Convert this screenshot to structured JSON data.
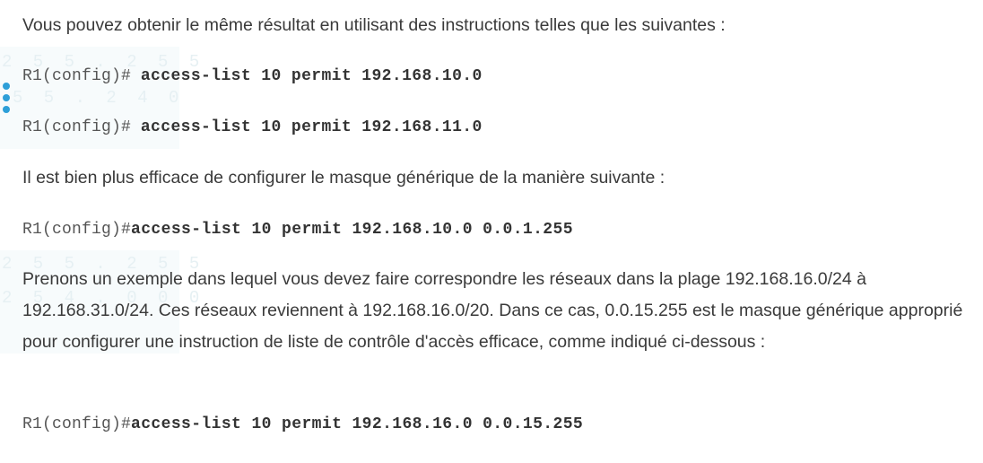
{
  "intro_text": "Vous pouvez obtenir le même résultat en utilisant des instructions telles que les suivantes :",
  "code_block_1": [
    {
      "prompt": "R1(config)#",
      "command": "access-list 10 permit 192.168.10.0"
    },
    {
      "prompt": "R1(config)#",
      "command": "access-list 10 permit 192.168.11.0"
    }
  ],
  "efficiency_text": "Il est bien plus efficace de configurer le masque générique de la manière suivante :",
  "code_block_2": {
    "prompt": "R1(config)#",
    "command": "access-list 10 permit 192.168.10.0 0.0.1.255"
  },
  "example_text": "Prenons un exemple dans lequel vous devez faire correspondre les réseaux dans la plage 192.168.16.0/24 à 192.168.31.0/24. Ces réseaux reviennent à 192.168.16.0/20. Dans ce cas, 0.0.15.255 est le masque générique approprié pour configurer une instruction de liste de contrôle d'accès efficace, comme indiqué ci-dessous :",
  "code_block_3": {
    "prompt": "R1(config)#",
    "command": "access-list 10 permit 192.168.16.0 0.0.15.255"
  },
  "background_ghost_text": [
    "2 5 5 . 2 5 5",
    "5 5 . 2 4 0",
    "2 5 5 . 2 5 5",
    "2 5 4 . 0 0 0"
  ],
  "colors": {
    "body_text": "#3a3a3a",
    "code_prompt": "#555555",
    "code_command": "#333333",
    "dot_accent": "#2d9fd8",
    "ghost_background": "#f7fbfc"
  }
}
